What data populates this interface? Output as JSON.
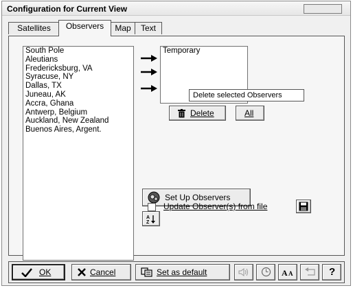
{
  "window": {
    "title": "Configuration for Current View"
  },
  "tabs": [
    {
      "label": "Satellites",
      "active": false
    },
    {
      "label": "Observers",
      "active": true
    },
    {
      "label": "Map",
      "active": false
    },
    {
      "label": "Text",
      "active": false
    }
  ],
  "available_observers": [
    "South Pole",
    "Aleutians",
    "Fredericksburg, VA",
    "Syracuse, NY",
    "Dallas, TX",
    "Juneau, AK",
    "Accra, Ghana",
    "Antwerp, Belgium",
    "Auckland, New Zealand",
    "Buenos Aires, Argent."
  ],
  "selected_observers": [
    "Temporary"
  ],
  "buttons": {
    "delete": "Delete",
    "all": "All",
    "setup_observers": "Set Up Observers",
    "sort_icon": "sort-ascending-icon"
  },
  "tooltip": "Delete selected Observers",
  "update_from_file": {
    "label": "Update Observer(s) from file",
    "checked": false
  },
  "bottom": {
    "ok": "OK",
    "cancel": "Cancel",
    "set_default": "Set as default",
    "help": "?"
  }
}
